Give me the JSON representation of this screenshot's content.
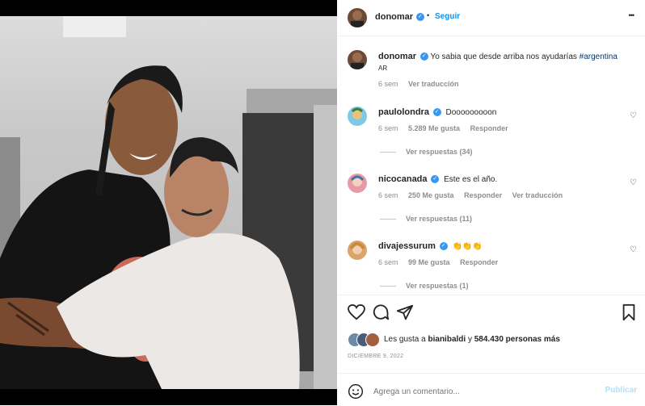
{
  "header": {
    "username": "donomar",
    "dot": "•",
    "follow_label": "Seguir",
    "more_label": "•••"
  },
  "caption": {
    "username": "donomar",
    "text": "Yo sabia que desde arriba nos ayudarías",
    "hashtag": "#argentina",
    "extra": "AR",
    "time": "6 sem",
    "translate": "Ver traducción"
  },
  "comments": [
    {
      "username": "paulolondra",
      "text": "Dooooooooon",
      "time": "6 sem",
      "likes": "5.289 Me gusta",
      "reply": "Responder",
      "translate": "",
      "replies": "Ver respuestas (34)"
    },
    {
      "username": "nicocanada",
      "text": "Este es el año.",
      "time": "6 sem",
      "likes": "250 Me gusta",
      "reply": "Responder",
      "translate": "Ver traducción",
      "replies": "Ver respuestas (11)"
    },
    {
      "username": "divajessurum",
      "text": "👏👏👏",
      "time": "6 sem",
      "likes": "99 Me gusta",
      "reply": "Responder",
      "translate": "",
      "replies": "Ver respuestas (1)"
    }
  ],
  "likes": {
    "prefix": "Les gusta a",
    "user": "bianibaldi",
    "middle": "y",
    "count": "584.430 personas más"
  },
  "date": "DICIEMBRE 9, 2022",
  "comment_input": {
    "placeholder": "Agrega un comentario...",
    "publish": "Publicar"
  },
  "colors": {
    "accent": "#0095f6",
    "link": "#00376b",
    "verified": "#3897f0",
    "muted": "#8e8e8e"
  },
  "icons": [
    "heart-icon",
    "comment-icon",
    "share-icon",
    "bookmark-icon",
    "emoji-icon",
    "more-icon",
    "verified-icon"
  ]
}
